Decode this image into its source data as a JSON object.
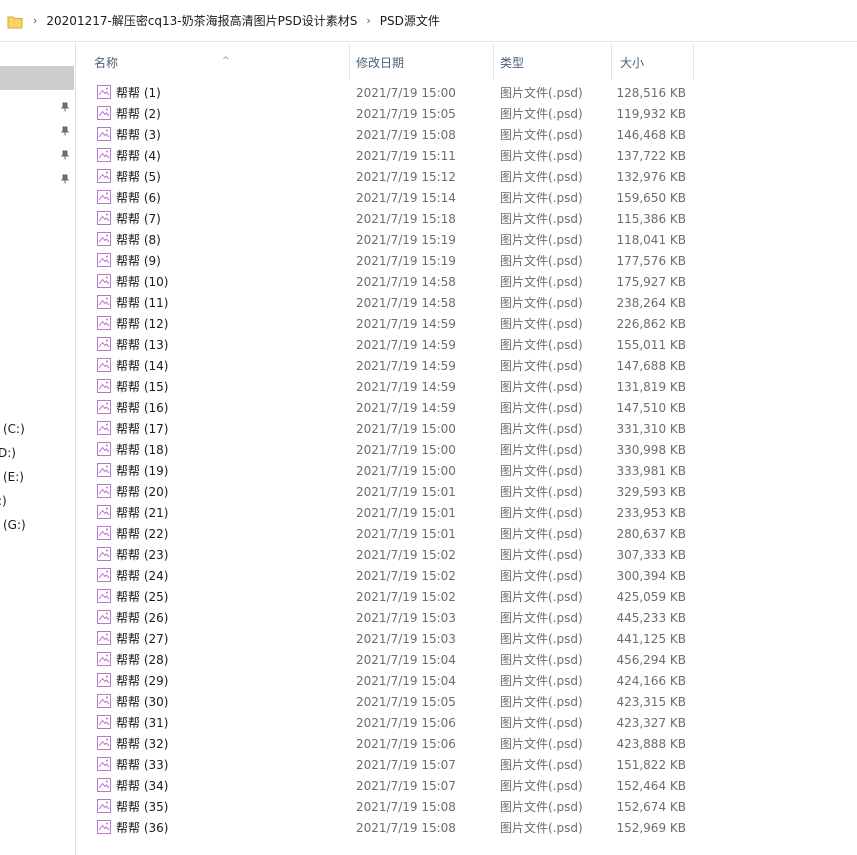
{
  "breadcrumb": {
    "path_1": "20201217-解压密cq13-奶茶海报高清图片PSD设计素材S",
    "path_2": "PSD源文件"
  },
  "nav": {
    "drives": [
      "(C:)",
      "D:)",
      "(E:)",
      ":)",
      "(G:)"
    ]
  },
  "columns": {
    "name": "名称",
    "date": "修改日期",
    "type": "类型",
    "size": "大小"
  },
  "files": [
    {
      "name": "帮帮 (1)",
      "date": "2021/7/19 15:00",
      "type": "图片文件(.psd)",
      "size": "128,516 KB"
    },
    {
      "name": "帮帮 (2)",
      "date": "2021/7/19 15:05",
      "type": "图片文件(.psd)",
      "size": "119,932 KB"
    },
    {
      "name": "帮帮 (3)",
      "date": "2021/7/19 15:08",
      "type": "图片文件(.psd)",
      "size": "146,468 KB"
    },
    {
      "name": "帮帮 (4)",
      "date": "2021/7/19 15:11",
      "type": "图片文件(.psd)",
      "size": "137,722 KB"
    },
    {
      "name": "帮帮 (5)",
      "date": "2021/7/19 15:12",
      "type": "图片文件(.psd)",
      "size": "132,976 KB"
    },
    {
      "name": "帮帮 (6)",
      "date": "2021/7/19 15:14",
      "type": "图片文件(.psd)",
      "size": "159,650 KB"
    },
    {
      "name": "帮帮 (7)",
      "date": "2021/7/19 15:18",
      "type": "图片文件(.psd)",
      "size": "115,386 KB"
    },
    {
      "name": "帮帮 (8)",
      "date": "2021/7/19 15:19",
      "type": "图片文件(.psd)",
      "size": "118,041 KB"
    },
    {
      "name": "帮帮 (9)",
      "date": "2021/7/19 15:19",
      "type": "图片文件(.psd)",
      "size": "177,576 KB"
    },
    {
      "name": "帮帮 (10)",
      "date": "2021/7/19 14:58",
      "type": "图片文件(.psd)",
      "size": "175,927 KB"
    },
    {
      "name": "帮帮 (11)",
      "date": "2021/7/19 14:58",
      "type": "图片文件(.psd)",
      "size": "238,264 KB"
    },
    {
      "name": "帮帮 (12)",
      "date": "2021/7/19 14:59",
      "type": "图片文件(.psd)",
      "size": "226,862 KB"
    },
    {
      "name": "帮帮 (13)",
      "date": "2021/7/19 14:59",
      "type": "图片文件(.psd)",
      "size": "155,011 KB"
    },
    {
      "name": "帮帮 (14)",
      "date": "2021/7/19 14:59",
      "type": "图片文件(.psd)",
      "size": "147,688 KB"
    },
    {
      "name": "帮帮 (15)",
      "date": "2021/7/19 14:59",
      "type": "图片文件(.psd)",
      "size": "131,819 KB"
    },
    {
      "name": "帮帮 (16)",
      "date": "2021/7/19 14:59",
      "type": "图片文件(.psd)",
      "size": "147,510 KB"
    },
    {
      "name": "帮帮 (17)",
      "date": "2021/7/19 15:00",
      "type": "图片文件(.psd)",
      "size": "331,310 KB"
    },
    {
      "name": "帮帮 (18)",
      "date": "2021/7/19 15:00",
      "type": "图片文件(.psd)",
      "size": "330,998 KB"
    },
    {
      "name": "帮帮 (19)",
      "date": "2021/7/19 15:00",
      "type": "图片文件(.psd)",
      "size": "333,981 KB"
    },
    {
      "name": "帮帮 (20)",
      "date": "2021/7/19 15:01",
      "type": "图片文件(.psd)",
      "size": "329,593 KB"
    },
    {
      "name": "帮帮 (21)",
      "date": "2021/7/19 15:01",
      "type": "图片文件(.psd)",
      "size": "233,953 KB"
    },
    {
      "name": "帮帮 (22)",
      "date": "2021/7/19 15:01",
      "type": "图片文件(.psd)",
      "size": "280,637 KB"
    },
    {
      "name": "帮帮 (23)",
      "date": "2021/7/19 15:02",
      "type": "图片文件(.psd)",
      "size": "307,333 KB"
    },
    {
      "name": "帮帮 (24)",
      "date": "2021/7/19 15:02",
      "type": "图片文件(.psd)",
      "size": "300,394 KB"
    },
    {
      "name": "帮帮 (25)",
      "date": "2021/7/19 15:02",
      "type": "图片文件(.psd)",
      "size": "425,059 KB"
    },
    {
      "name": "帮帮 (26)",
      "date": "2021/7/19 15:03",
      "type": "图片文件(.psd)",
      "size": "445,233 KB"
    },
    {
      "name": "帮帮 (27)",
      "date": "2021/7/19 15:03",
      "type": "图片文件(.psd)",
      "size": "441,125 KB"
    },
    {
      "name": "帮帮 (28)",
      "date": "2021/7/19 15:04",
      "type": "图片文件(.psd)",
      "size": "456,294 KB"
    },
    {
      "name": "帮帮 (29)",
      "date": "2021/7/19 15:04",
      "type": "图片文件(.psd)",
      "size": "424,166 KB"
    },
    {
      "name": "帮帮 (30)",
      "date": "2021/7/19 15:05",
      "type": "图片文件(.psd)",
      "size": "423,315 KB"
    },
    {
      "name": "帮帮 (31)",
      "date": "2021/7/19 15:06",
      "type": "图片文件(.psd)",
      "size": "423,327 KB"
    },
    {
      "name": "帮帮 (32)",
      "date": "2021/7/19 15:06",
      "type": "图片文件(.psd)",
      "size": "423,888 KB"
    },
    {
      "name": "帮帮 (33)",
      "date": "2021/7/19 15:07",
      "type": "图片文件(.psd)",
      "size": "151,822 KB"
    },
    {
      "name": "帮帮 (34)",
      "date": "2021/7/19 15:07",
      "type": "图片文件(.psd)",
      "size": "152,464 KB"
    },
    {
      "name": "帮帮 (35)",
      "date": "2021/7/19 15:08",
      "type": "图片文件(.psd)",
      "size": "152,674 KB"
    },
    {
      "name": "帮帮 (36)",
      "date": "2021/7/19 15:08",
      "type": "图片文件(.psd)",
      "size": "152,969 KB"
    }
  ],
  "icons": {
    "folder": "folder-icon",
    "file": "psd-file-icon",
    "pin": "pin-icon",
    "chevron": "chevron-right-icon",
    "sort": "sort-up-icon"
  },
  "colors": {
    "folder": "#f8d26a",
    "file_icon": "#b678c8",
    "selection": "#cccccc",
    "header_text": "#4c607a"
  }
}
